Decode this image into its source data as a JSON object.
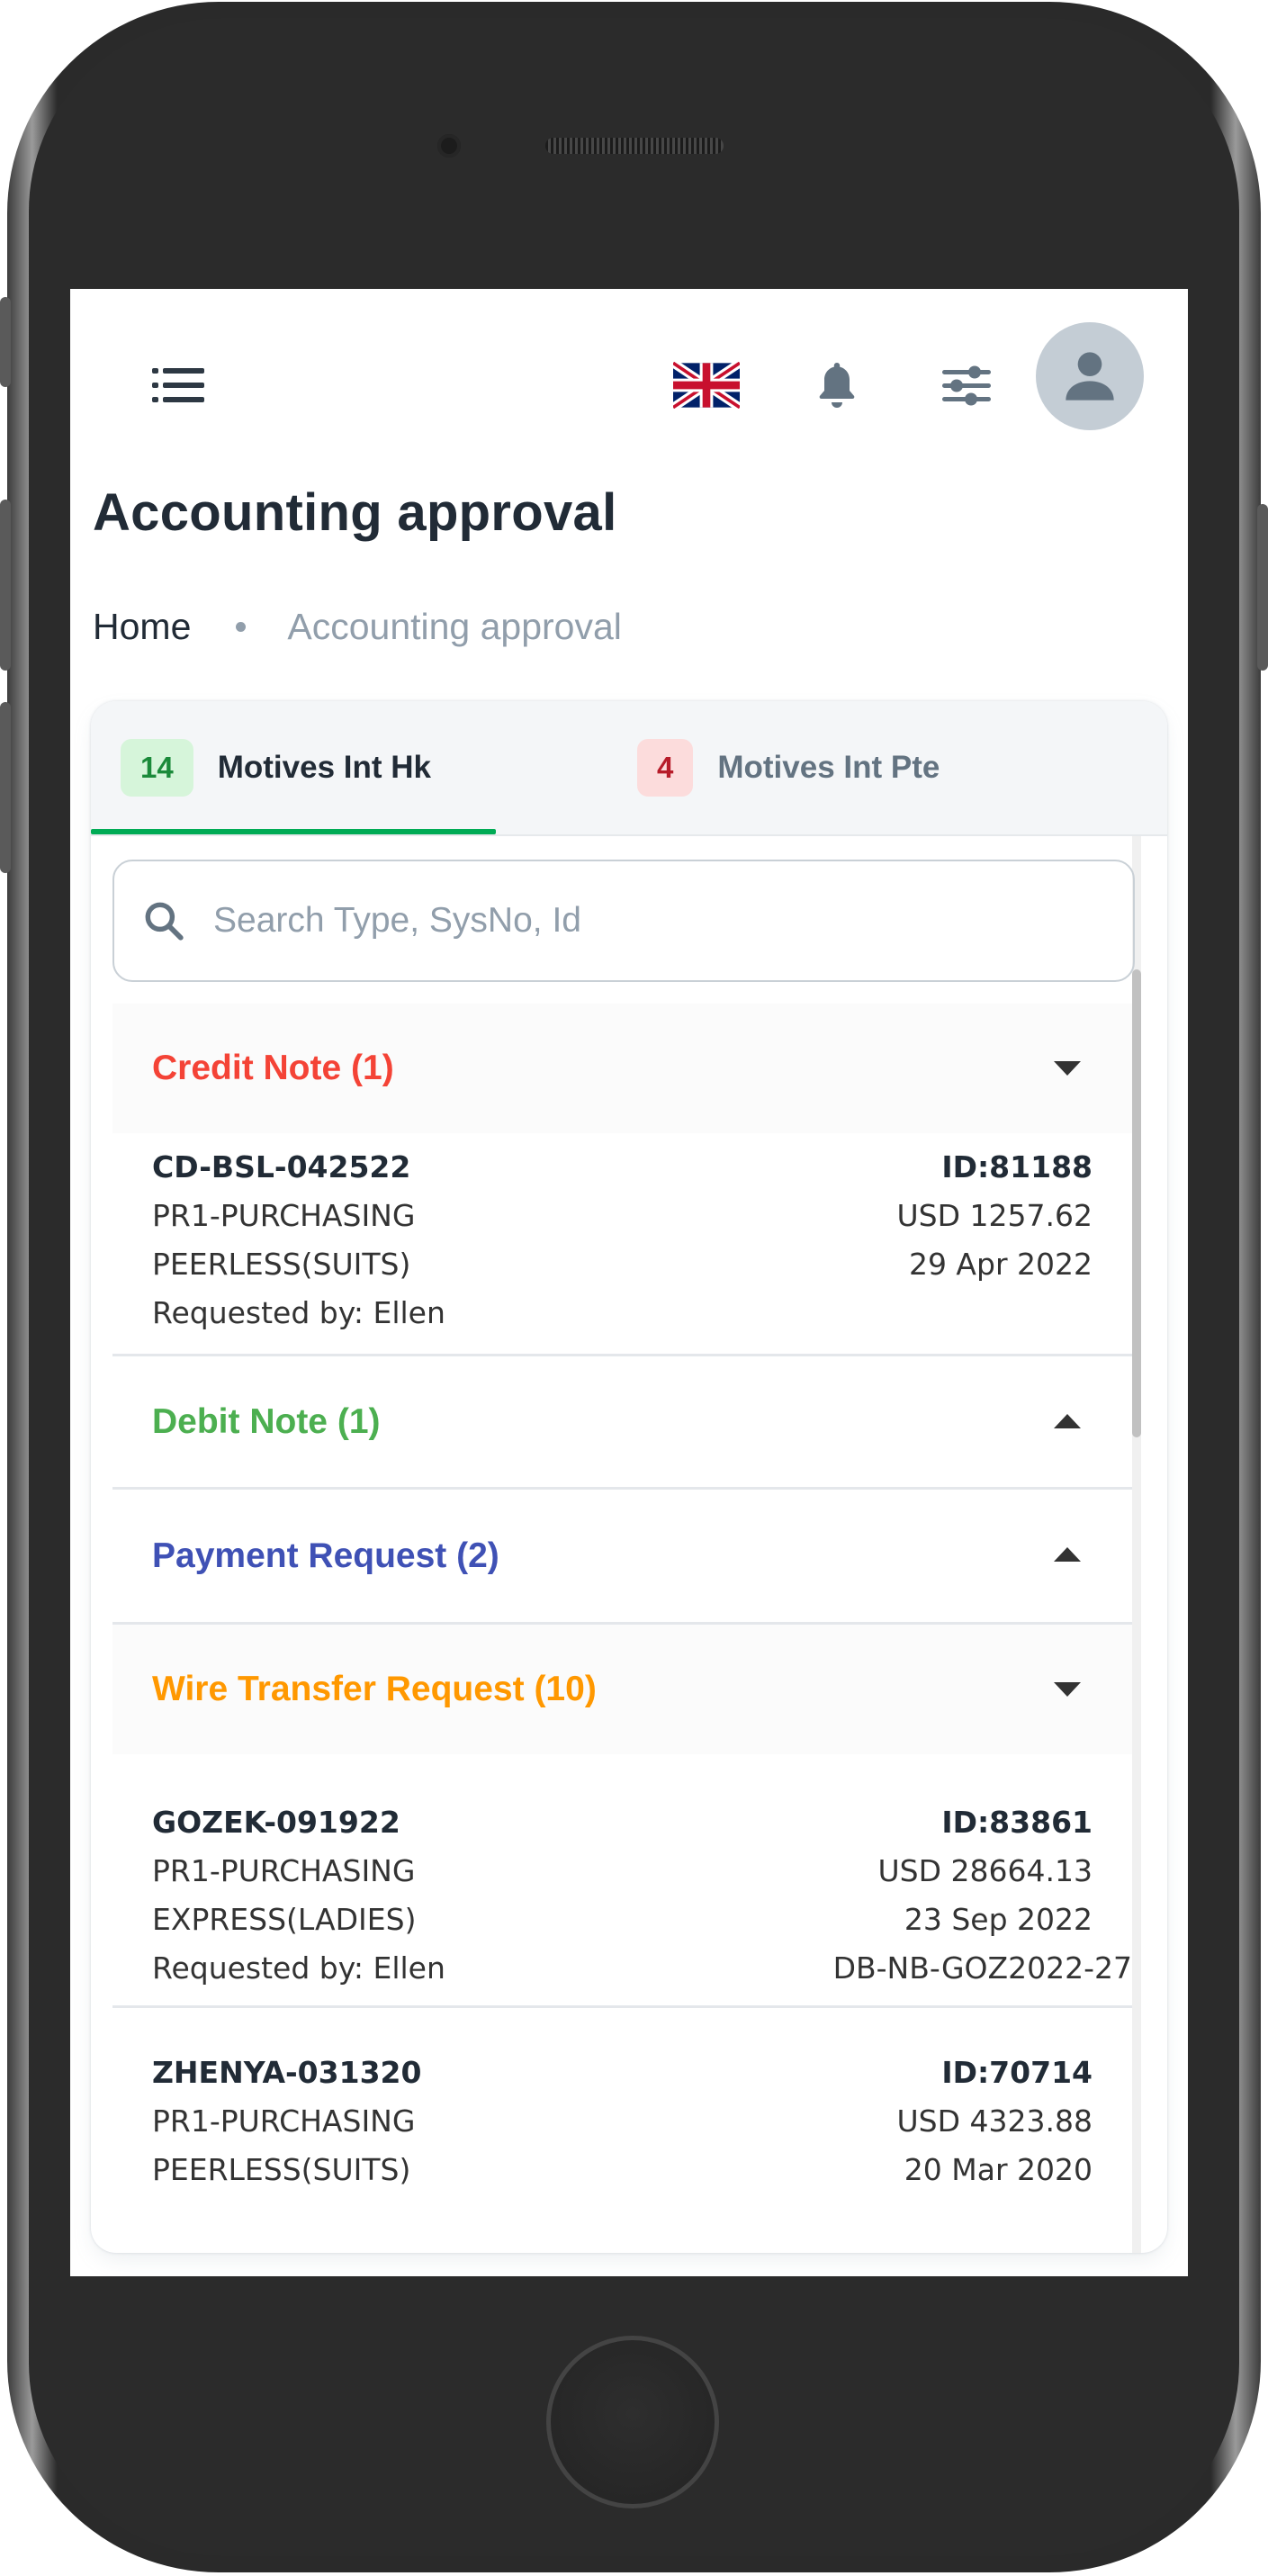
{
  "header": {
    "menu_icon": "hamburger-menu-icon",
    "language_icon": "uk-flag-icon",
    "notifications_icon": "bell-icon",
    "filter_icon": "sliders-icon",
    "avatar_icon": "user-icon"
  },
  "page": {
    "title": "Accounting approval",
    "breadcrumb": [
      "Home",
      "Accounting approval"
    ]
  },
  "tabs": [
    {
      "count": "14",
      "label": "Motives Int Hk",
      "active": true,
      "count_color": "#1b8a3a"
    },
    {
      "count": "4",
      "label": "Motives Int Pte",
      "active": false,
      "count_color": "#b71d2a"
    }
  ],
  "search": {
    "placeholder": "Search Type, SysNo, Id",
    "value": ""
  },
  "groups": [
    {
      "title": "Credit Note (1)",
      "color": "#f44336",
      "expanded": true,
      "items": [
        {
          "ref": "CD-BSL-042522",
          "id": "ID:81188",
          "dept": "PR1-PURCHASING",
          "amount": "USD 1257.62",
          "vendor": "PEERLESS(SUITS)",
          "date": "29 Apr 2022",
          "requester": "Requested by: Ellen"
        }
      ]
    },
    {
      "title": "Debit Note (1)",
      "color": "#4caf50",
      "expanded": false,
      "items": []
    },
    {
      "title": "Payment Request (2)",
      "color": "#3f51b5",
      "expanded": false,
      "items": []
    },
    {
      "title": "Wire Transfer Request (10)",
      "color": "#ff9800",
      "expanded": true,
      "items": [
        {
          "ref": "GOZEK-091922",
          "id": "ID:83861",
          "dept": "PR1-PURCHASING",
          "amount": "USD 28664.13",
          "vendor": "EXPRESS(LADIES)",
          "date": "23 Sep 2022",
          "requester": "Requested by: Ellen",
          "note": "DB-NB-GOZ2022-27"
        },
        {
          "ref": "ZHENYA-031320",
          "id": "ID:70714",
          "dept": "PR1-PURCHASING",
          "amount": "USD 4323.88",
          "vendor": "PEERLESS(SUITS)",
          "date": "20 Mar 2020"
        }
      ]
    }
  ]
}
